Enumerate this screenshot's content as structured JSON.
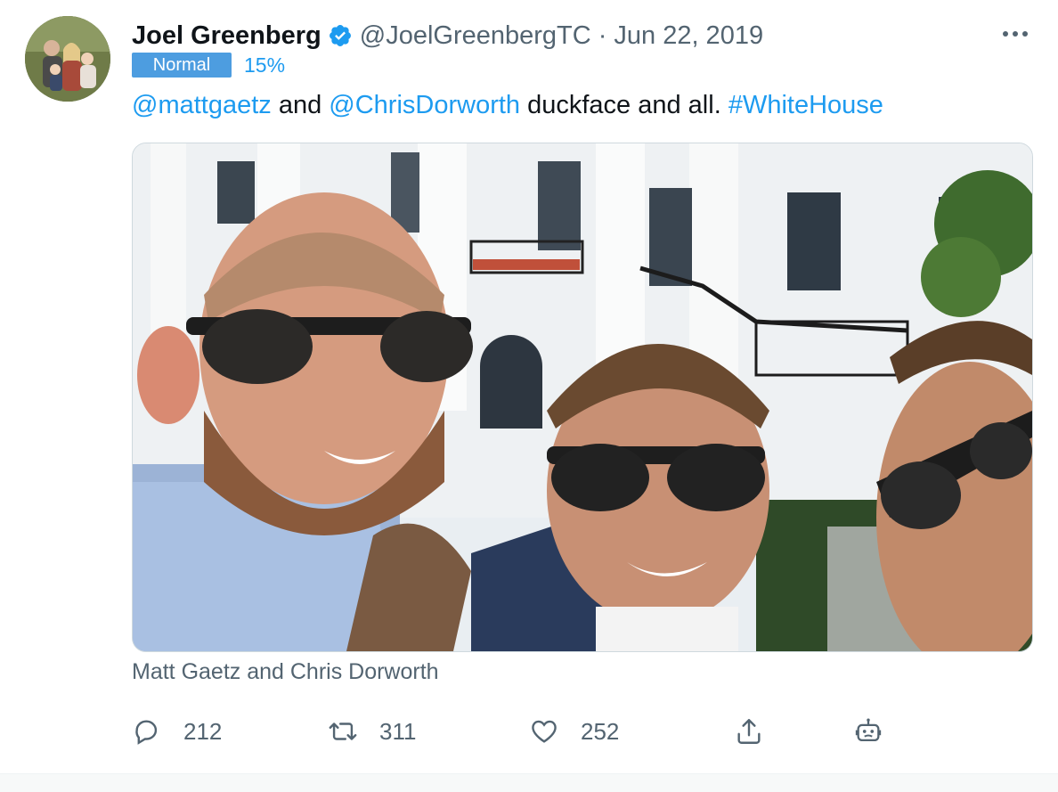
{
  "tweet": {
    "author_name": "Joel Greenberg",
    "handle": "@JoelGreenbergTC",
    "separator": "·",
    "date": "Jun 22, 2019",
    "badge_label": "Normal",
    "badge_percent": "15%",
    "text_parts": {
      "mention1": "@mattgaetz",
      "and": " and ",
      "mention2": "@ChrisDorworth",
      "middle": " duckface and all. ",
      "hashtag": "#WhiteHouse"
    },
    "media_caption": "Matt Gaetz and Chris Dorworth"
  },
  "actions": {
    "reply_count": "212",
    "retweet_count": "311",
    "like_count": "252"
  },
  "icons": {
    "verified": "verified-badge-icon",
    "more": "more-options-icon",
    "reply": "reply-icon",
    "retweet": "retweet-icon",
    "like": "heart-icon",
    "share": "share-icon",
    "bot": "robot-icon"
  },
  "colors": {
    "accent": "#1d9bf0",
    "badge_bg": "#4d9de0",
    "muted_text": "#536471",
    "primary_text": "#0f1419"
  }
}
